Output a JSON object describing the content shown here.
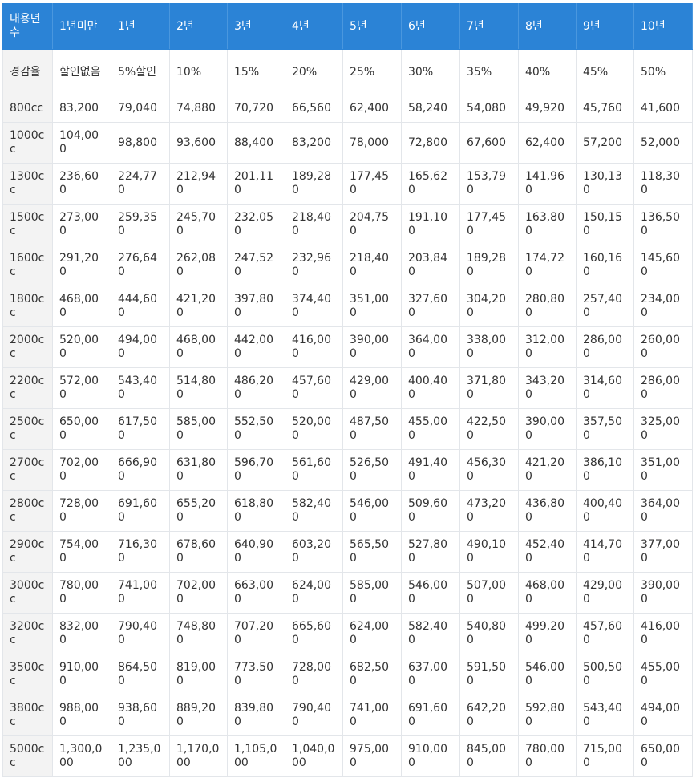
{
  "headers": [
    "내용년수",
    "1년미만",
    "1년",
    "2년",
    "3년",
    "4년",
    "5년",
    "6년",
    "7년",
    "8년",
    "9년",
    "10년"
  ],
  "rate_row": [
    "경감율",
    "할인없음",
    "5%할인",
    "10%",
    "15%",
    "20%",
    "25%",
    "30%",
    "35%",
    "40%",
    "45%",
    "50%"
  ],
  "rows": [
    [
      "800cc",
      "83,200",
      "79,040",
      "74,880",
      "70,720",
      "66,560",
      "62,400",
      "58,240",
      "54,080",
      "49,920",
      "45,760",
      "41,600"
    ],
    [
      "1000cc",
      "104,000",
      "98,800",
      "93,600",
      "88,400",
      "83,200",
      "78,000",
      "72,800",
      "67,600",
      "62,400",
      "57,200",
      "52,000"
    ],
    [
      "1300cc",
      "236,600",
      "224,770",
      "212,940",
      "201,110",
      "189,280",
      "177,450",
      "165,620",
      "153,790",
      "141,960",
      "130,130",
      "118,300"
    ],
    [
      "1500cc",
      "273,000",
      "259,350",
      "245,700",
      "232,050",
      "218,400",
      "204,750",
      "191,100",
      "177,450",
      "163,800",
      "150,150",
      "136,500"
    ],
    [
      "1600cc",
      "291,200",
      "276,640",
      "262,080",
      "247,520",
      "232,960",
      "218,400",
      "203,840",
      "189,280",
      "174,720",
      "160,160",
      "145,600"
    ],
    [
      "1800cc",
      "468,000",
      "444,600",
      "421,200",
      "397,800",
      "374,400",
      "351,000",
      "327,600",
      "304,200",
      "280,800",
      "257,400",
      "234,000"
    ],
    [
      "2000cc",
      "520,000",
      "494,000",
      "468,000",
      "442,000",
      "416,000",
      "390,000",
      "364,000",
      "338,000",
      "312,000",
      "286,000",
      "260,000"
    ],
    [
      "2200cc",
      "572,000",
      "543,400",
      "514,800",
      "486,200",
      "457,600",
      "429,000",
      "400,400",
      "371,800",
      "343,200",
      "314,600",
      "286,000"
    ],
    [
      "2500cc",
      "650,000",
      "617,500",
      "585,000",
      "552,500",
      "520,000",
      "487,500",
      "455,000",
      "422,500",
      "390,000",
      "357,500",
      "325,000"
    ],
    [
      "2700cc",
      "702,000",
      "666,900",
      "631,800",
      "596,700",
      "561,600",
      "526,500",
      "491,400",
      "456,300",
      "421,200",
      "386,100",
      "351,000"
    ],
    [
      "2800cc",
      "728,000",
      "691,600",
      "655,200",
      "618,800",
      "582,400",
      "546,000",
      "509,600",
      "473,200",
      "436,800",
      "400,400",
      "364,000"
    ],
    [
      "2900cc",
      "754,000",
      "716,300",
      "678,600",
      "640,900",
      "603,200",
      "565,500",
      "527,800",
      "490,100",
      "452,400",
      "414,700",
      "377,000"
    ],
    [
      "3000cc",
      "780,000",
      "741,000",
      "702,000",
      "663,000",
      "624,000",
      "585,000",
      "546,000",
      "507,000",
      "468,000",
      "429,000",
      "390,000"
    ],
    [
      "3200cc",
      "832,000",
      "790,400",
      "748,800",
      "707,200",
      "665,600",
      "624,000",
      "582,400",
      "540,800",
      "499,200",
      "457,600",
      "416,000"
    ],
    [
      "3500cc",
      "910,000",
      "864,500",
      "819,000",
      "773,500",
      "728,000",
      "682,500",
      "637,000",
      "591,500",
      "546,000",
      "500,500",
      "455,000"
    ],
    [
      "3800cc",
      "988,000",
      "938,600",
      "889,200",
      "839,800",
      "790,400",
      "741,000",
      "691,600",
      "642,200",
      "592,800",
      "543,400",
      "494,000"
    ],
    [
      "5000cc",
      "1,300,000",
      "1,235,000",
      "1,170,000",
      "1,105,000",
      "1,040,000",
      "975,000",
      "910,000",
      "845,000",
      "780,000",
      "715,000",
      "650,000"
    ]
  ]
}
